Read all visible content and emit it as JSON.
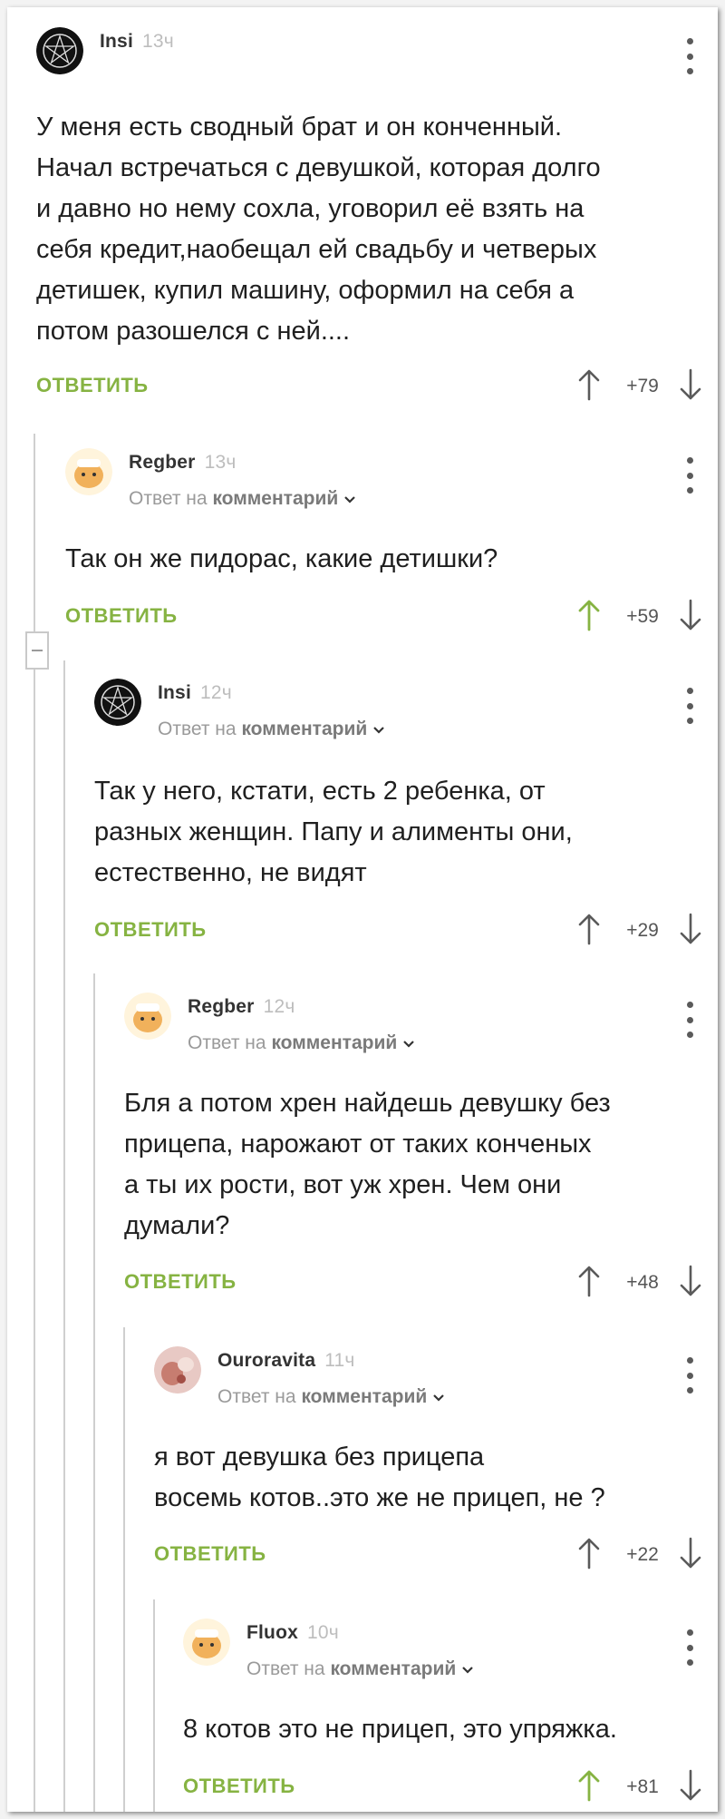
{
  "colors": {
    "accent_green": "#86b342",
    "vote_active": "#86b342",
    "vote_inactive": "#5a5a5a"
  },
  "comments": [
    {
      "author": "Insi",
      "time": "13ч",
      "avatar_icon": "pentagram-avatar-icon",
      "text": "У меня есть сводный брат и он конченный.\nНачал встречаться с девушкой, которая долго\nи давно но нему сохла, уговорил её взять на\nсебя кредит,наобещал ей свадьбу и четверых\nдетишек, купил машину, оформил на себя а\nпотом разошелся с ней....",
      "reply_label": "ОТВЕТИТЬ",
      "score": "+79",
      "upvoted": false
    },
    {
      "author": "Regber",
      "time": "13ч",
      "avatar_icon": "cartoon-face-avatar-icon",
      "reply_to_prefix": "Ответ на",
      "reply_to_target": "комментарий",
      "text": "Так он же пидорас, какие детишки?",
      "reply_label": "ОТВЕТИТЬ",
      "score": "+59",
      "upvoted": true
    },
    {
      "author": "Insi",
      "time": "12ч",
      "avatar_icon": "pentagram-avatar-icon",
      "reply_to_prefix": "Ответ на",
      "reply_to_target": "комментарий",
      "text": "Так у него, кстати, есть 2 ребенка, от\nразных женщин. Папу и алименты они,\nестественно, не видят",
      "reply_label": "ОТВЕТИТЬ",
      "score": "+29",
      "upvoted": false
    },
    {
      "author": "Regber",
      "time": "12ч",
      "avatar_icon": "cartoon-face-avatar-icon",
      "reply_to_prefix": "Ответ на",
      "reply_to_target": "комментарий",
      "text": "Бля а потом хрен найдешь девушку без\nприцепа, нарожают от таких конченых\nа ты их рости, вот уж хрен. Чем они\nдумали?",
      "reply_label": "ОТВЕТИТЬ",
      "score": "+48",
      "upvoted": false
    },
    {
      "author": "Ouroravita",
      "time": "11ч",
      "avatar_icon": "photo-avatar-icon",
      "reply_to_prefix": "Ответ на",
      "reply_to_target": "комментарий",
      "text": "я вот девушка без прицепа\nвосемь котов..это же не прицеп, не ?",
      "reply_label": "ОТВЕТИТЬ",
      "score": "+22",
      "upvoted": false
    },
    {
      "author": "Fluox",
      "time": "10ч",
      "avatar_icon": "cartoon-face-avatar-icon",
      "reply_to_prefix": "Ответ на",
      "reply_to_target": "комментарий",
      "text": "8 котов это не прицеп, это упряжка.",
      "reply_label": "ОТВЕТИТЬ",
      "score": "+81",
      "upvoted": true
    }
  ]
}
